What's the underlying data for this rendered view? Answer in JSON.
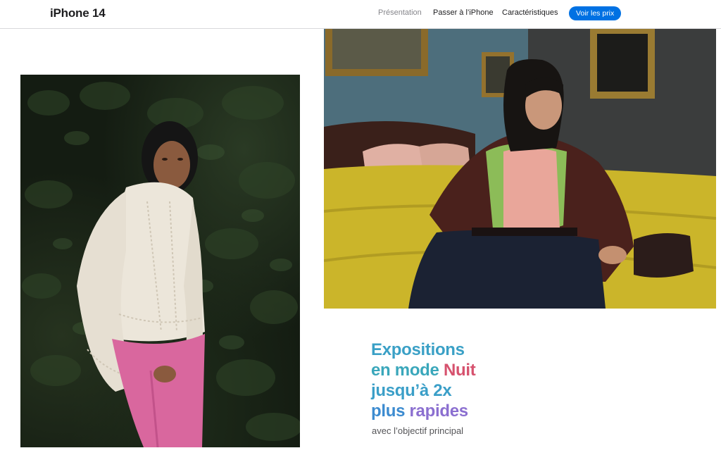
{
  "nav": {
    "product_title": "iPhone 14",
    "links": [
      {
        "label": "Présentation"
      },
      {
        "label": "Passer à l’iPhone"
      },
      {
        "label": "Caractéristiques"
      }
    ],
    "buy_label": "Voir les prix"
  },
  "hero": {
    "headline": {
      "line1": "Expositions",
      "line2_a": "en mode ",
      "line2_b": "Nuit",
      "line3": "jusqu’à 2x",
      "line4_a": "plus ",
      "line4_b": "rapides"
    },
    "subhead": "avec l’objectif principal"
  },
  "colors": {
    "accent_blue": "#0071e3",
    "gradient_teal": "#3aa0c6",
    "gradient_pink": "#d6526e",
    "gradient_violet": "#8b6fd0"
  }
}
